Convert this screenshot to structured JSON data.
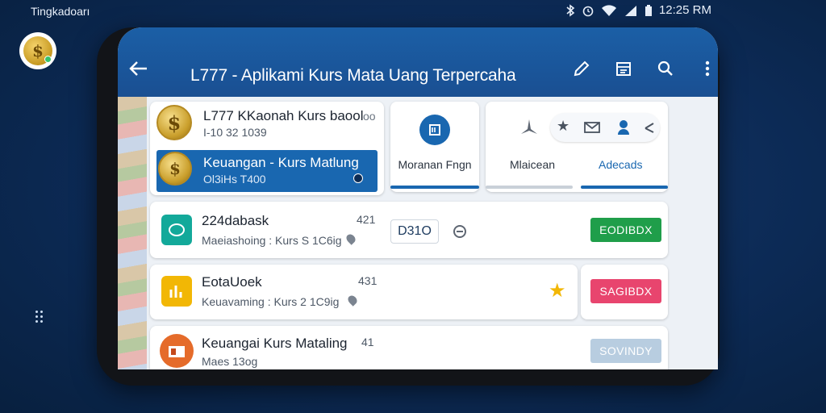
{
  "status_bar": {
    "left_text": "Tingkadoarı",
    "time": "12:25 RM",
    "icons": [
      "bluetooth-icon",
      "alarm-icon",
      "wifi-icon",
      "signal-icon",
      "battery-icon"
    ]
  },
  "app_bar": {
    "title": "L777 - Aplikami Kurs Mata Uang Terpercaha",
    "actions": [
      "edit-icon",
      "calendar-icon",
      "search-icon",
      "more-icon"
    ]
  },
  "featured": {
    "title": "L777 KKaonah Kurs baool",
    "title_trail": "oo",
    "subtitle": "I-10 32 1039",
    "highlight_title": "Keuangan - Kurs Matlung",
    "highlight_sub": "Ol3iHs T400"
  },
  "tabs_left": {
    "label": "Moranan Fngn"
  },
  "tabs_right": {
    "items": [
      "Mlaicean",
      "Adecads"
    ]
  },
  "list": [
    {
      "title": "224dabask",
      "subtitle": "Maeiashoing : Kurs S 1C6ig",
      "meta": "421",
      "code": "D31O",
      "button": "EODIBDX",
      "button_color": "#1f9e4a",
      "icon_color": "#13a99a"
    },
    {
      "title": "EotaUoek",
      "subtitle": "Keuavaming : Kurs 2 1C9ig",
      "meta": "431",
      "button": "SAGIBDX",
      "button_color": "#e8456e",
      "icon_color": "#f2b705"
    },
    {
      "title": "Keuangai Kurs Mataling",
      "subtitle": "Maes 13og",
      "meta": "41",
      "button": "SOVINDY",
      "button_color": "#b8cde0",
      "icon_color": "#e56b2a"
    }
  ],
  "colors": {
    "app_bar": "#1a5a9f",
    "accent_blue": "#1967b0",
    "background": "#0c2a55"
  }
}
